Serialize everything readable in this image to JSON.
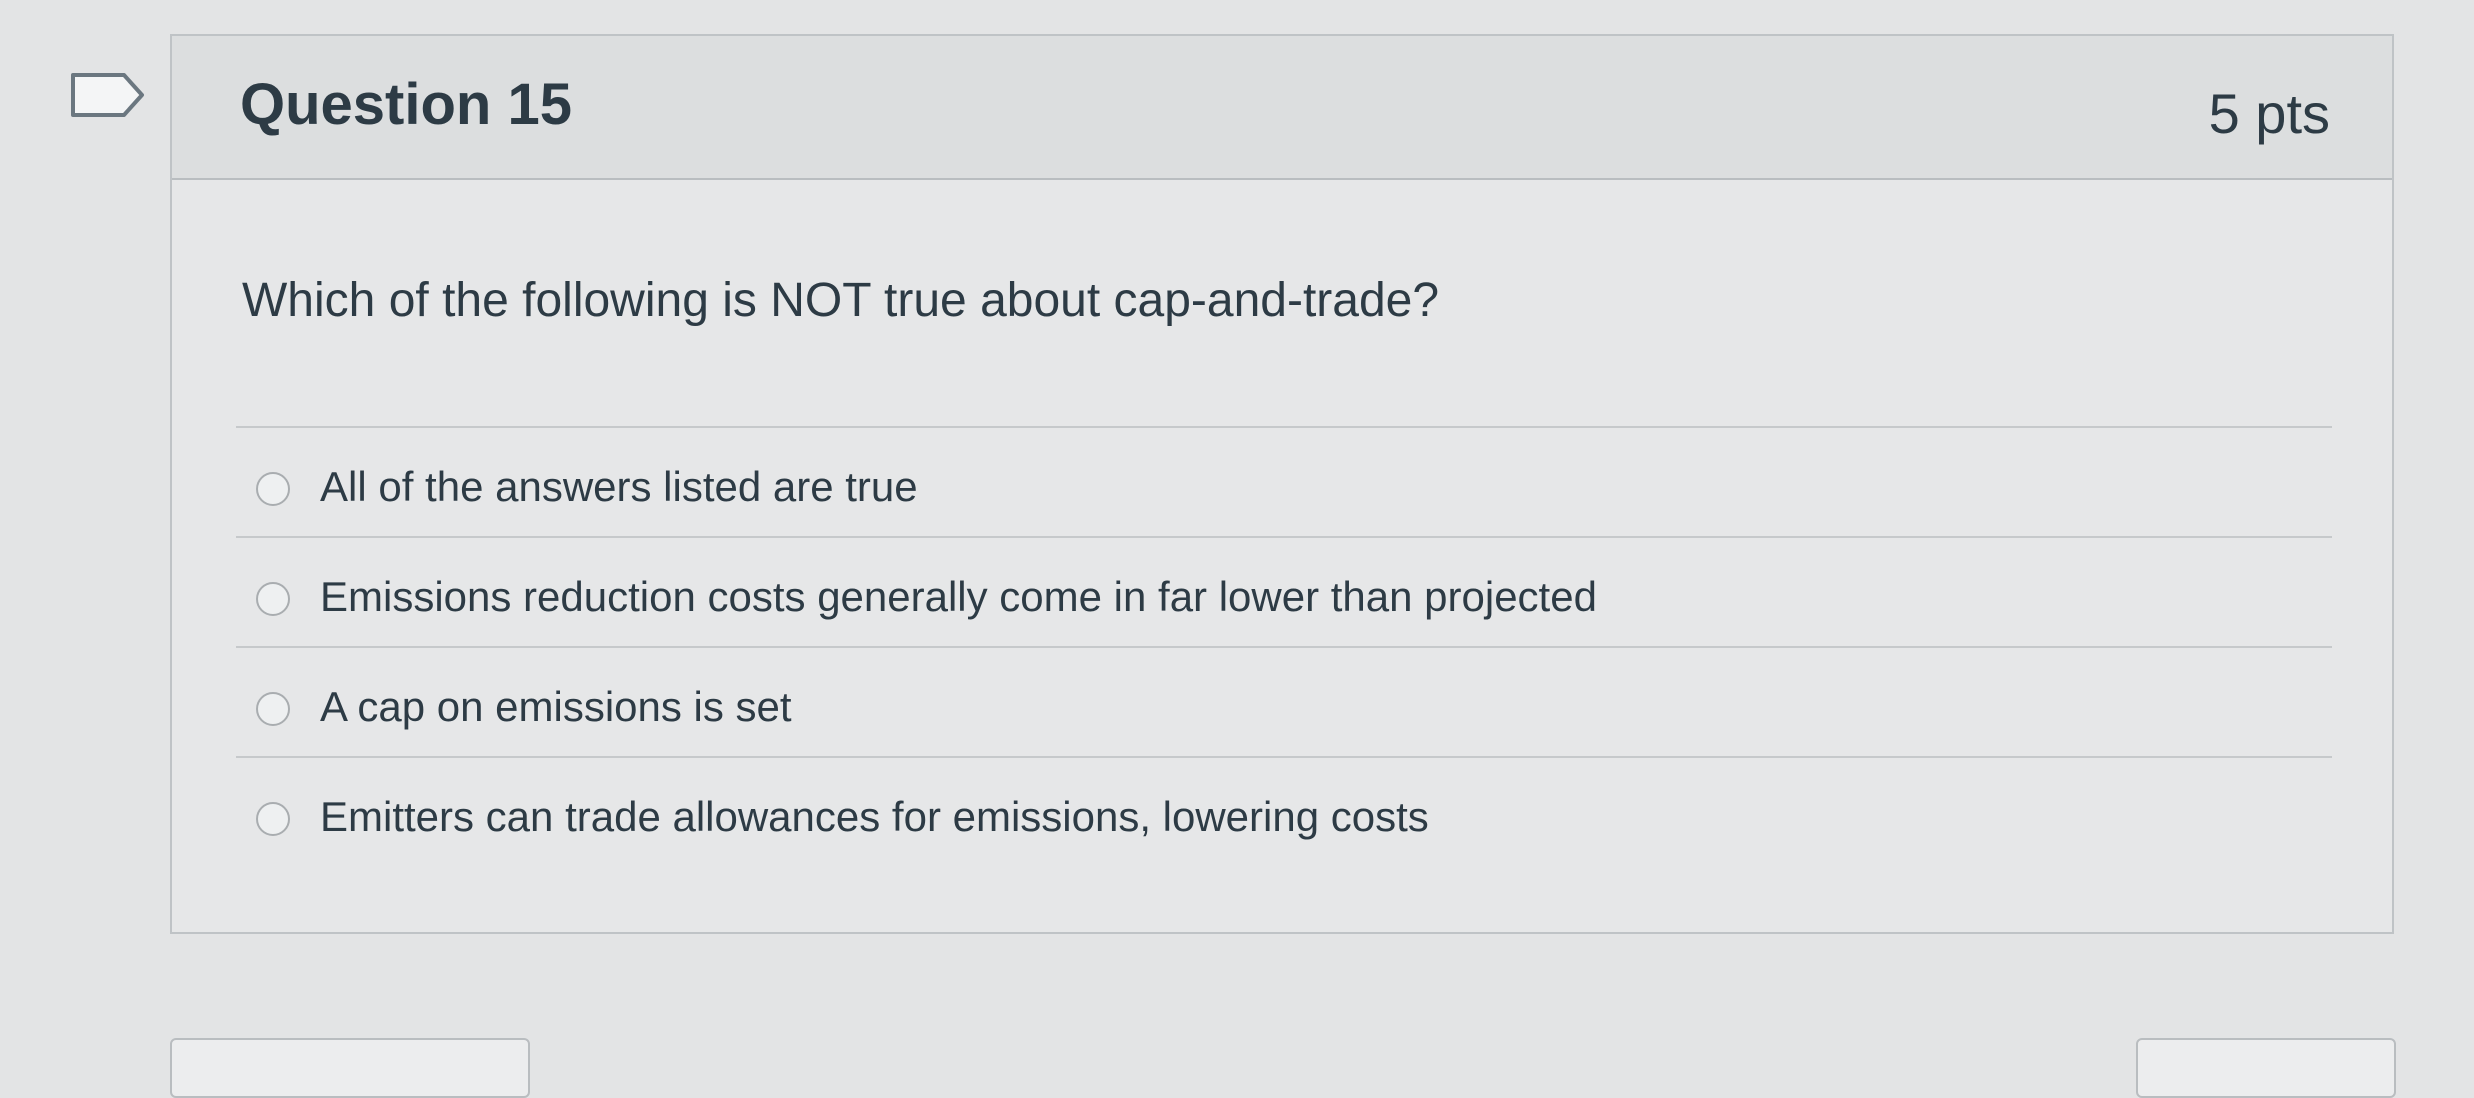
{
  "question": {
    "title": "Question 15",
    "points": "5 pts",
    "text": "Which of the following is NOT true about cap-and-trade?",
    "answers": [
      {
        "label": "All of the answers listed are true"
      },
      {
        "label": "Emissions reduction costs generally come in far lower than projected"
      },
      {
        "label": "A cap on emissions is set"
      },
      {
        "label": "Emitters can trade allowances for emissions, lowering costs"
      }
    ]
  },
  "icons": {
    "bookmark": "bookmark-flag-icon",
    "radio": "radio-button-icon"
  },
  "colors": {
    "text": "#2d3b45",
    "border": "#bfc3c6",
    "header_background": "#dcdedf"
  }
}
